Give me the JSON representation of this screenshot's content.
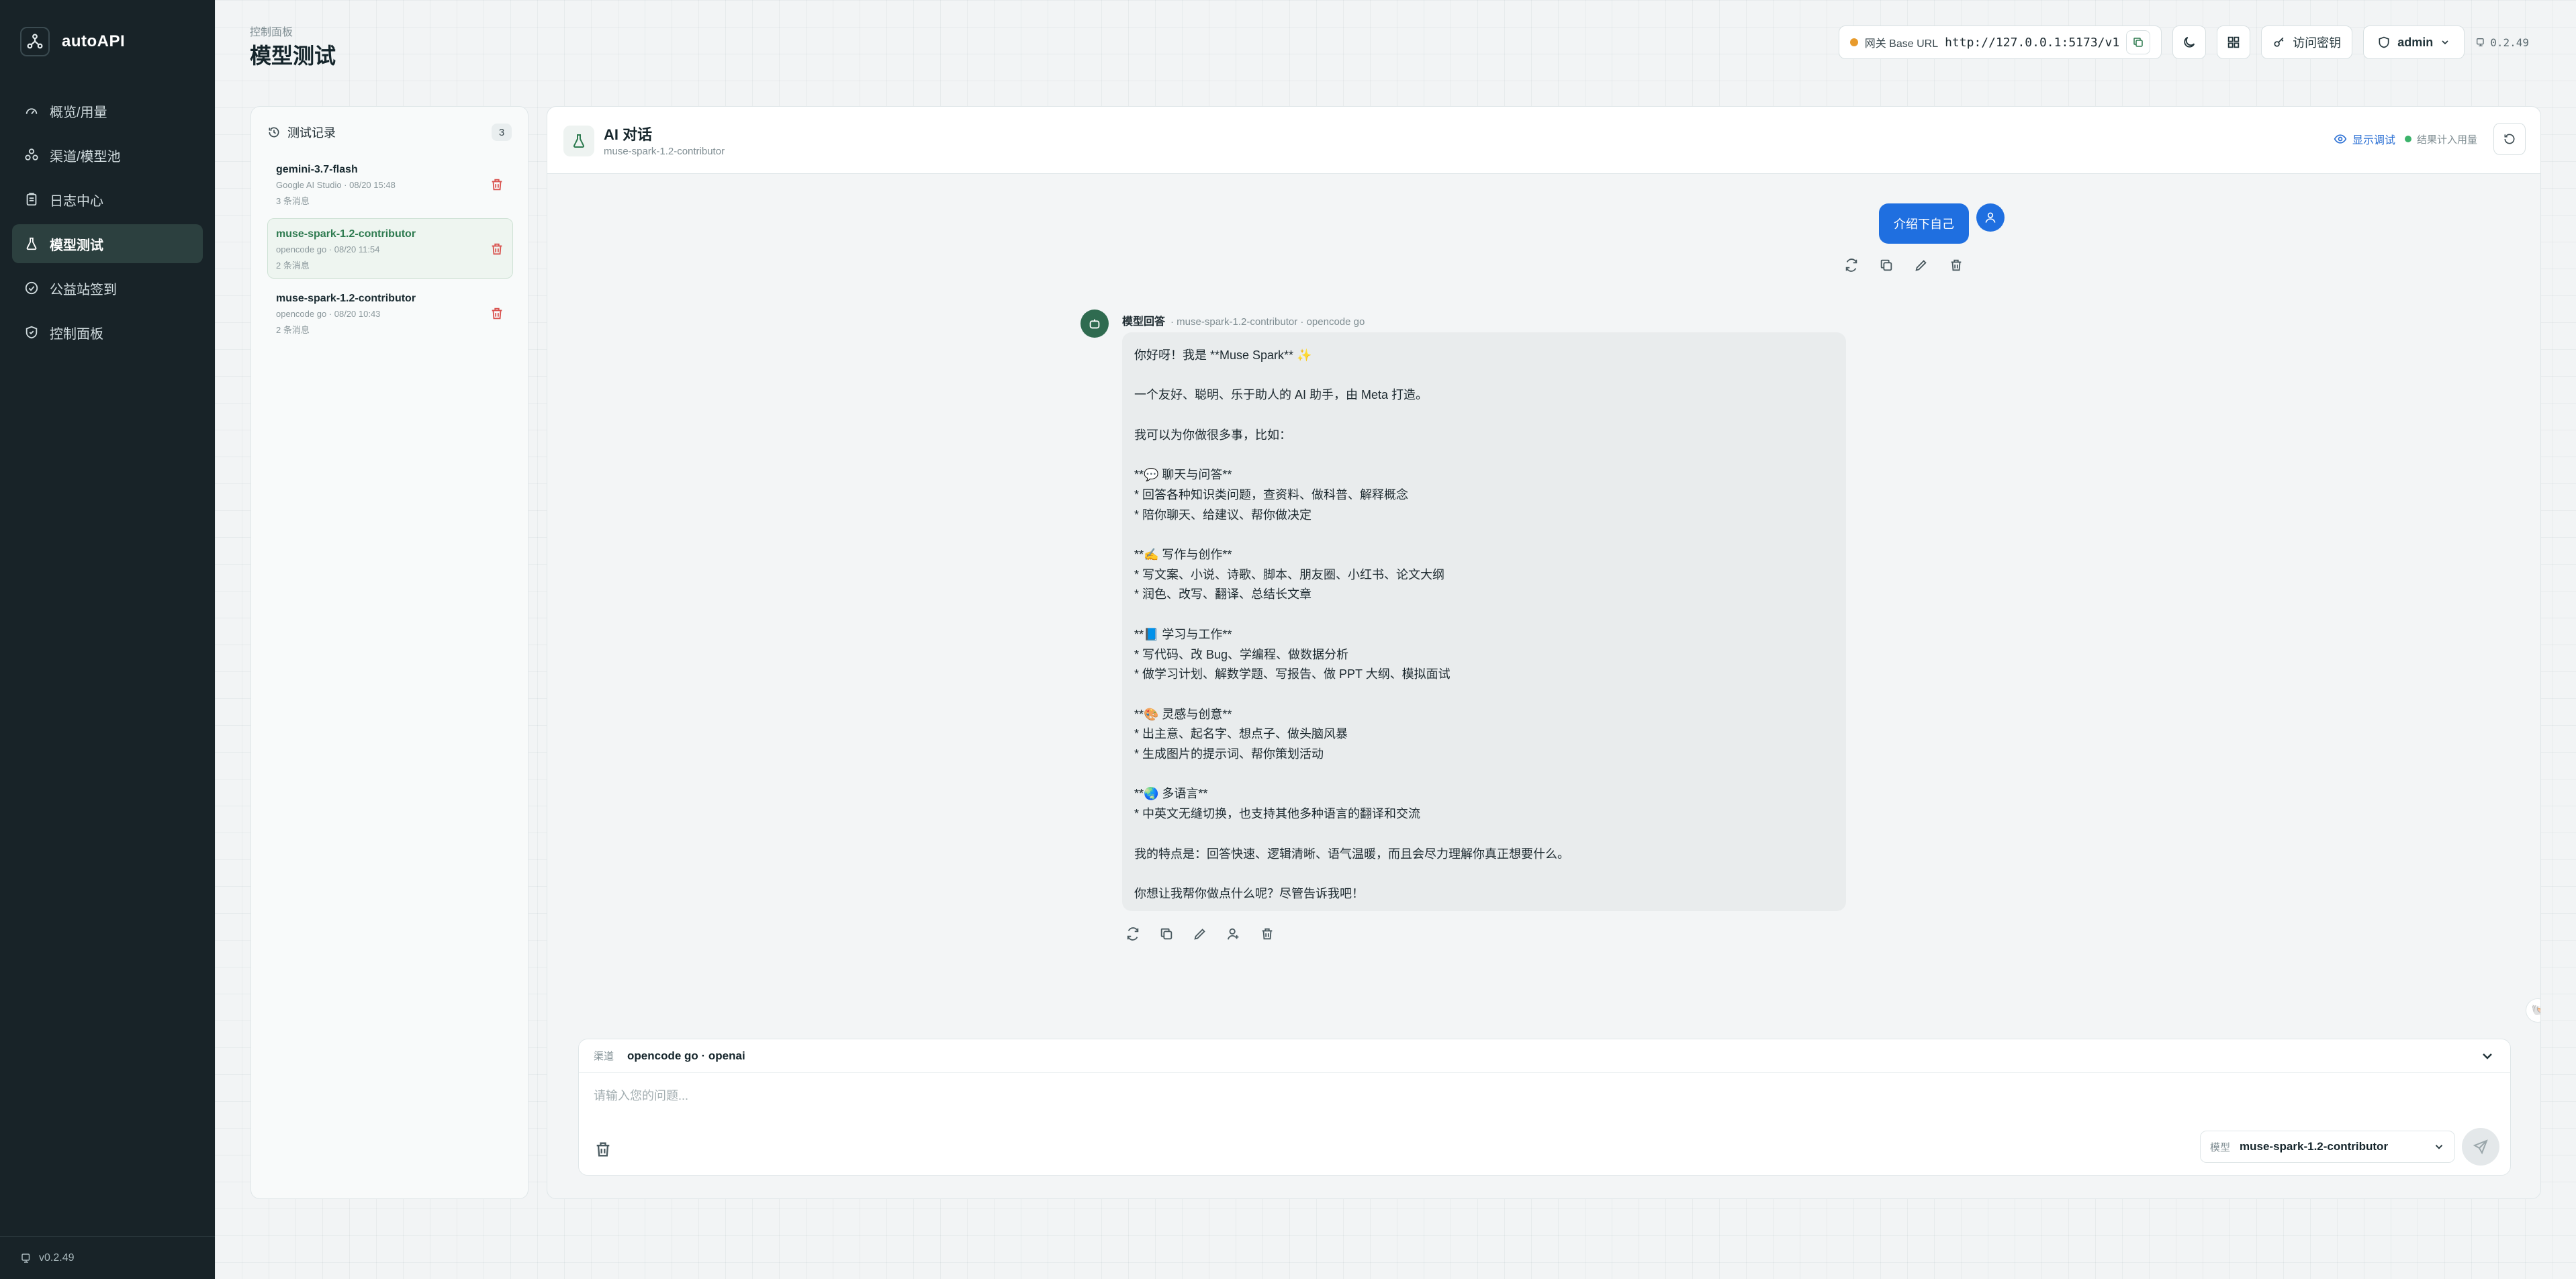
{
  "app": {
    "name": "autoAPI",
    "version": "v0.2.49"
  },
  "sidebar": {
    "items": [
      {
        "label": "概览/用量",
        "icon": "gauge-icon"
      },
      {
        "label": "渠道/模型池",
        "icon": "cubes-icon"
      },
      {
        "label": "日志中心",
        "icon": "clipboard-icon"
      },
      {
        "label": "模型测试",
        "icon": "flask-icon",
        "active": true
      },
      {
        "label": "公益站签到",
        "icon": "check-circle-icon"
      },
      {
        "label": "控制面板",
        "icon": "shield-icon"
      }
    ]
  },
  "header": {
    "breadcrumb": "控制面板",
    "title": "模型测试",
    "base_url_label": "网关 Base URL",
    "base_url": "http://127.0.0.1:5173/v1",
    "access_key_label": "访问密钥",
    "user": "admin",
    "version": "0.2.49"
  },
  "history": {
    "title": "测试记录",
    "count": "3",
    "items": [
      {
        "title": "gemini-3.7-flash",
        "meta": "Google AI Studio · 08/20 15:48",
        "count": "3 条消息"
      },
      {
        "title": "muse-spark-1.2-contributor",
        "meta": "opencode go · 08/20 11:54",
        "count": "2 条消息",
        "active": true
      },
      {
        "title": "muse-spark-1.2-contributor",
        "meta": "opencode go · 08/20 10:43",
        "count": "2 条消息"
      }
    ]
  },
  "chat": {
    "title": "AI 对话",
    "subtitle": "muse-spark-1.2-contributor",
    "show_debug": "显示调试",
    "usage_note": "结果计入用量",
    "user_message": "介绍下自己",
    "bot_label": "模型回答",
    "bot_meta": "· muse-spark-1.2-contributor · opencode go",
    "bot_message": "你好呀！我是 **Muse Spark** ✨\n\n一个友好、聪明、乐于助人的 AI 助手，由 Meta 打造。\n\n我可以为你做很多事，比如：\n\n**💬 聊天与问答**\n* 回答各种知识类问题，查资料、做科普、解释概念\n* 陪你聊天、给建议、帮你做决定\n\n**✍️ 写作与创作**\n* 写文案、小说、诗歌、脚本、朋友圈、小红书、论文大纲\n* 润色、改写、翻译、总结长文章\n\n**📘 学习与工作**\n* 写代码、改 Bug、学编程、做数据分析\n* 做学习计划、解数学题、写报告、做 PPT 大纲、模拟面试\n\n**🎨 灵感与创意**\n* 出主意、起名字、想点子、做头脑风暴\n* 生成图片的提示词、帮你策划活动\n\n**🌏 多语言**\n* 中英文无缝切换，也支持其他多种语言的翻译和交流\n\n我的特点是：回答快速、逻辑清晰、语气温暖，而且会尽力理解你真正想要什么。\n\n你想让我帮你做点什么呢？尽管告诉我吧！"
  },
  "composer": {
    "channel_label": "渠道",
    "channel_value": "opencode go · openai",
    "placeholder": "请输入您的问题...",
    "model_label": "模型",
    "model_value": "muse-spark-1.2-contributor"
  },
  "colors": {
    "accent": "#1f6fe0",
    "sidebar_bg": "#182328",
    "active_green": "#2d7a4f",
    "delete_red": "#d9534f"
  }
}
